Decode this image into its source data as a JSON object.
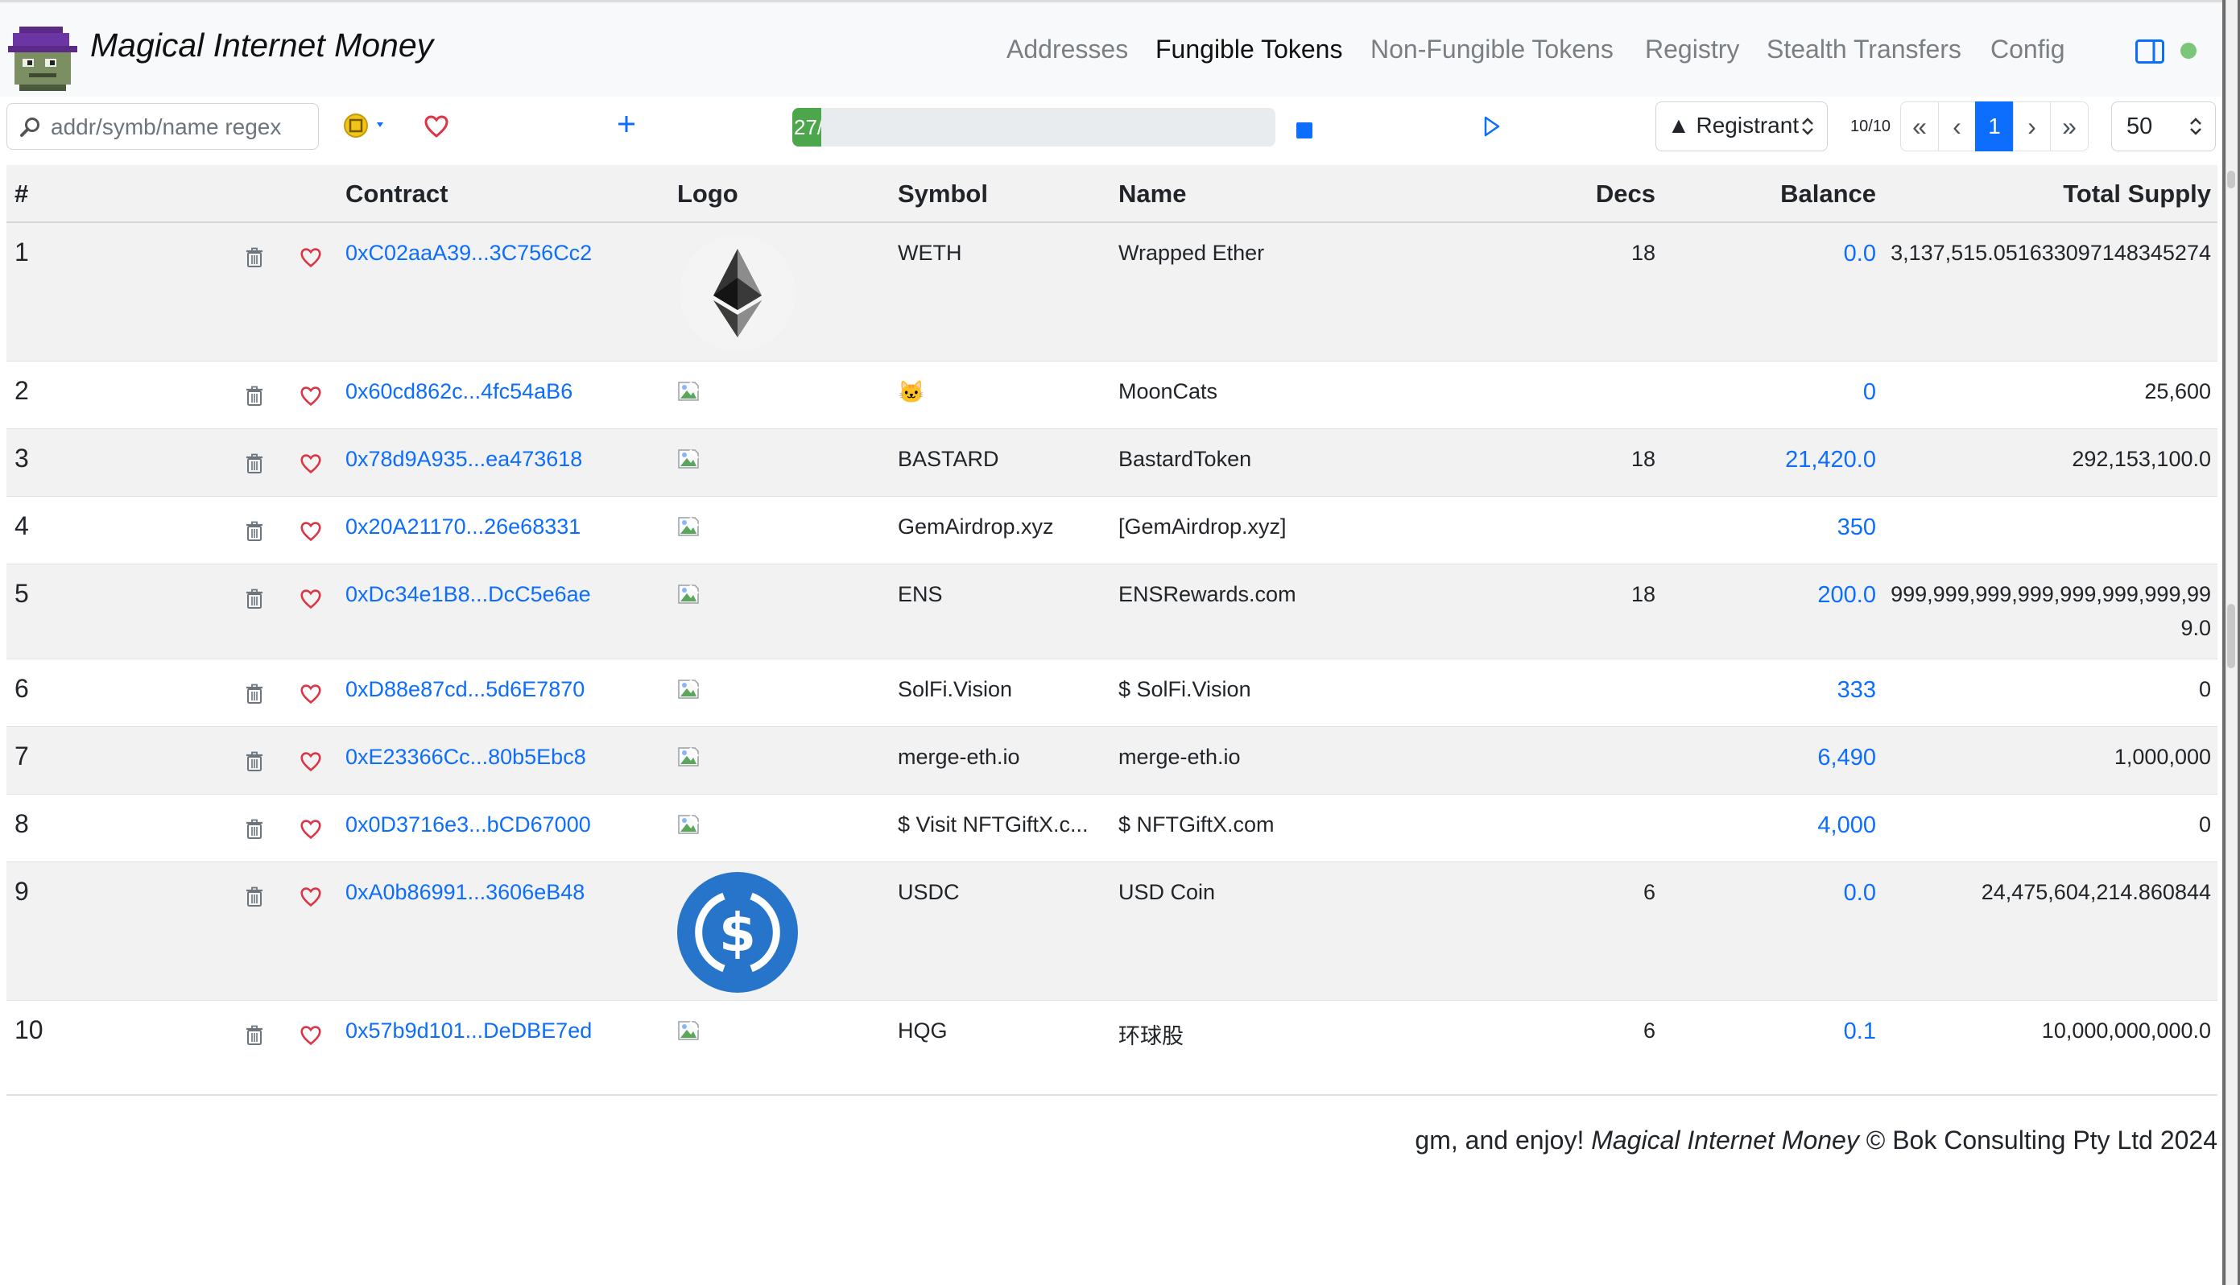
{
  "app": {
    "title": "Magical Internet Money"
  },
  "nav": {
    "items": [
      {
        "label": "Addresses",
        "active": false
      },
      {
        "label": "Fungible Tokens",
        "active": true
      },
      {
        "label": "Non-Fungible Tokens",
        "active": false
      },
      {
        "label": "Registry",
        "active": false
      },
      {
        "label": "Stealth Transfers",
        "active": false
      },
      {
        "label": "Config",
        "active": false
      }
    ],
    "status_color": "#7ac77a"
  },
  "toolbar": {
    "search_placeholder": "addr/symb/name regex",
    "progress_label": "27/",
    "progress_fraction": 0.03,
    "sort_label": "▲ Registrant",
    "count": "10/10",
    "pager": [
      "«",
      "‹",
      "1",
      "›",
      "»"
    ],
    "per_page": "50"
  },
  "table": {
    "headers": {
      "num": "#",
      "contract": "Contract",
      "logo": "Logo",
      "symbol": "Symbol",
      "name": "Name",
      "decs": "Decs",
      "balance": "Balance",
      "supply": "Total Supply"
    },
    "rows": [
      {
        "num": "1",
        "contract": "0xC02aaA39...3C756Cc2",
        "logo": "eth-logo",
        "symbol": "WETH",
        "name": "Wrapped Ether",
        "decs": "18",
        "balance": "0.0",
        "supply": "3,137,515.051633097148345274"
      },
      {
        "num": "2",
        "contract": "0x60cd862c...4fc54aB6",
        "logo": "broken-image",
        "symbol": "🐱",
        "name": "MoonCats",
        "decs": "",
        "balance": "0",
        "supply": "25,600"
      },
      {
        "num": "3",
        "contract": "0x78d9A935...ea473618",
        "logo": "broken-image",
        "symbol": "BASTARD",
        "name": "BastardToken",
        "decs": "18",
        "balance": "21,420.0",
        "supply": "292,153,100.0"
      },
      {
        "num": "4",
        "contract": "0x20A21170...26e68331",
        "logo": "broken-image",
        "symbol": "GemAirdrop.xyz",
        "name": "[GemAirdrop.xyz]",
        "decs": "",
        "balance": "350",
        "supply": ""
      },
      {
        "num": "5",
        "contract": "0xDc34e1B8...DcC5e6ae",
        "logo": "broken-image",
        "symbol": "ENS",
        "name": "ENSRewards.com",
        "decs": "18",
        "balance": "200.0",
        "supply": "999,999,999,999,999,999,999,999.0"
      },
      {
        "num": "6",
        "contract": "0xD88e87cd...5d6E7870",
        "logo": "broken-image",
        "symbol": "SolFi.Vision",
        "name": "$ SolFi.Vision",
        "decs": "",
        "balance": "333",
        "supply": "0"
      },
      {
        "num": "7",
        "contract": "0xE23366Cc...80b5Ebc8",
        "logo": "broken-image",
        "symbol": "merge-eth.io",
        "name": "merge-eth.io",
        "decs": "",
        "balance": "6,490",
        "supply": "1,000,000"
      },
      {
        "num": "8",
        "contract": "0x0D3716e3...bCD67000",
        "logo": "broken-image",
        "symbol": "$ Visit NFTGiftX.c...",
        "name": "$ NFTGiftX.com",
        "decs": "",
        "balance": "4,000",
        "supply": "0"
      },
      {
        "num": "9",
        "contract": "0xA0b86991...3606eB48",
        "logo": "usdc-logo",
        "symbol": "USDC",
        "name": "USD Coin",
        "decs": "6",
        "balance": "0.0",
        "supply": "24,475,604,214.860844"
      },
      {
        "num": "10",
        "contract": "0x57b9d101...DeDBE7ed",
        "logo": "broken-image",
        "symbol": "HQG",
        "name": "环球股",
        "decs": "6",
        "balance": "0.1",
        "supply": "10,000,000,000.0"
      }
    ]
  },
  "footer": {
    "prefix": "gm, and enjoy! ",
    "app_name": "Magical Internet Money",
    "suffix": " © Bok Consulting Pty Ltd 2024"
  },
  "colors": {
    "accent": "#0d6efd",
    "progress": "#4ca64c",
    "heart": "#dc3545"
  }
}
